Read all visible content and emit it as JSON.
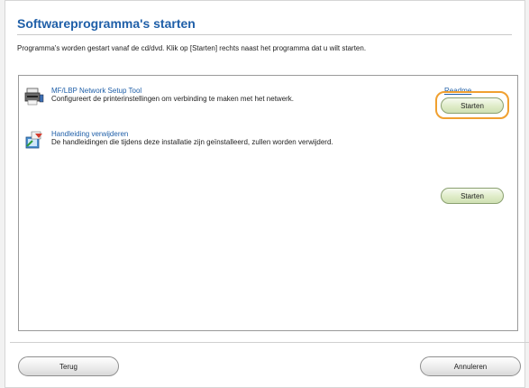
{
  "header": {
    "title": "Softwareprogramma's starten",
    "instruction": "Programma's worden gestart vanaf de cd/dvd. Klik op [Starten] rechts naast het programma dat u wilt starten."
  },
  "programs": [
    {
      "name": "MF/LBP Network Setup Tool",
      "description": "Configureert de printerinstellingen om verbinding te maken met het netwerk.",
      "readme_label": "Readme",
      "start_label": "Starten",
      "icon": "printer-icon"
    },
    {
      "name": "Handleiding verwijderen",
      "description": "De handleidingen die tijdens deze installatie zijn geïnstalleerd, zullen worden verwijderd.",
      "start_label": "Starten",
      "icon": "uninstall-icon"
    }
  ],
  "footer": {
    "back_label": "Terug",
    "cancel_label": "Annuleren"
  },
  "colors": {
    "title": "#1f5fa8",
    "focus_ring": "#f0a030",
    "start_button": "#dfecc8"
  }
}
